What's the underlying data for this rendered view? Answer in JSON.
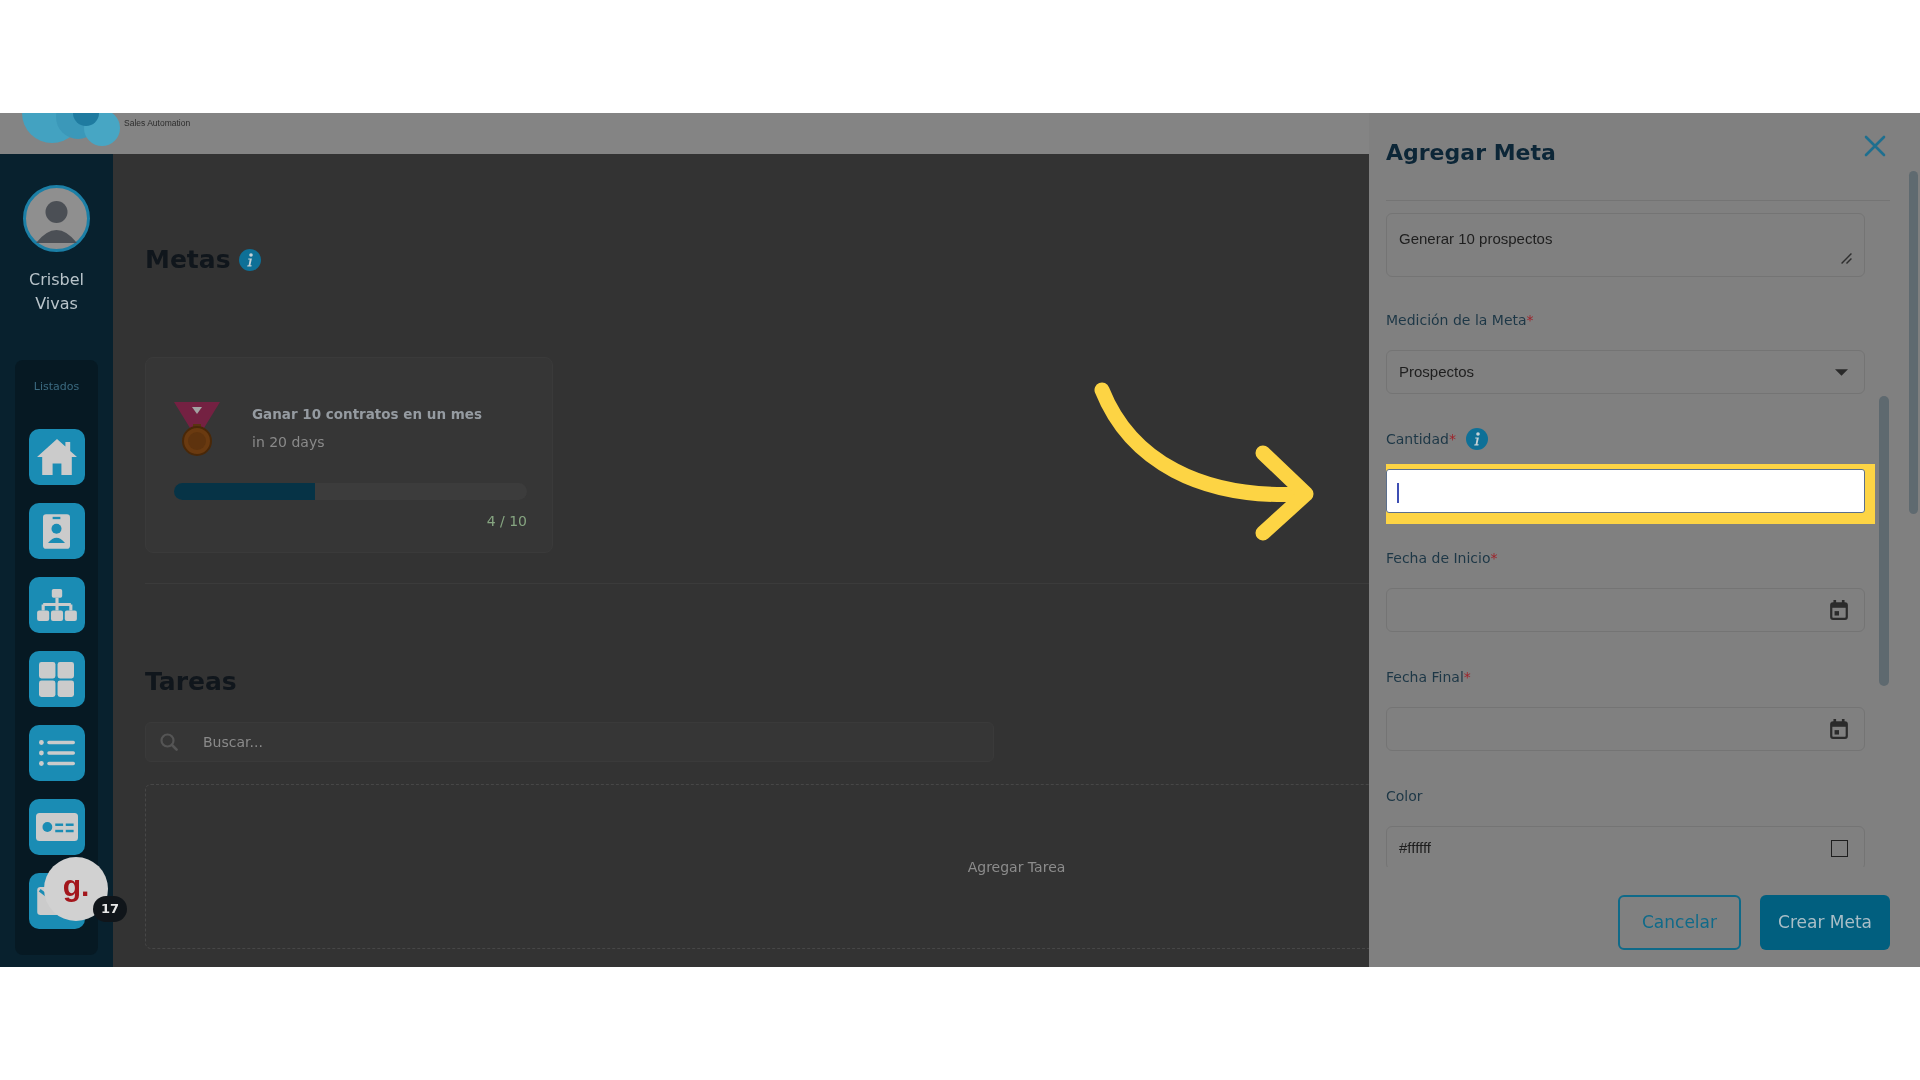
{
  "header": {
    "tagline": "Sales Automation"
  },
  "sidebar": {
    "user_name": "Crisbel Vivas",
    "section_label": "Listados"
  },
  "chat_widget": {
    "logo_text": "g.",
    "badge": "17"
  },
  "goals": {
    "title": "Metas",
    "info": true,
    "items": [
      {
        "title": "Ganar 10 contratos en un mes",
        "due": "in 20 days",
        "level": 0.4,
        "progress": "4 / 10"
      }
    ]
  },
  "tasks": {
    "title": "Tareas",
    "search": {
      "placeholder": "Buscar..."
    },
    "add_label": "Agregar Tarea"
  },
  "drawer": {
    "title": "Agregar Meta",
    "fields": [
      {
        "kind": "textarea",
        "value": "Generar 10 prospectos",
        "highlighted": false
      },
      {
        "kind": "select",
        "label": "Medición de la Meta",
        "required_mark": "*",
        "value": "Prospectos",
        "highlighted": false
      },
      {
        "kind": "number",
        "label": "Cantidad",
        "required_mark": "*",
        "info": true,
        "highlighted": true
      },
      {
        "kind": "date",
        "label": "Fecha de Inicio",
        "required_mark": "*",
        "highlighted": false
      },
      {
        "kind": "date",
        "label": "Fecha Final",
        "required_mark": "*",
        "highlighted": false
      },
      {
        "kind": "color",
        "label": "Color",
        "value": "#ffffff",
        "highlighted": false
      }
    ],
    "buttons": [
      {
        "label": "Cancelar",
        "kind": "outline"
      },
      {
        "label": "Crear Meta",
        "kind": "primary"
      }
    ]
  }
}
